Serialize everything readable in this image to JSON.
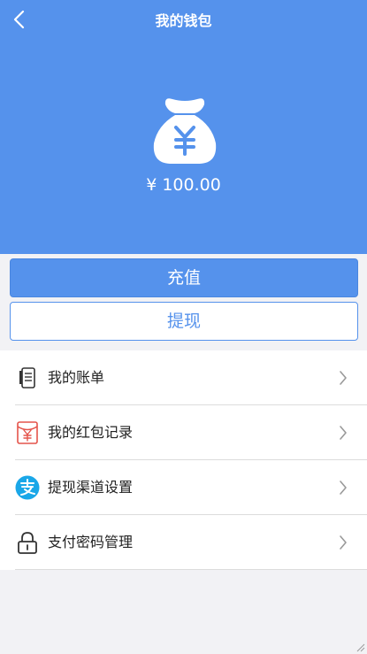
{
  "header": {
    "title": "我的钱包",
    "balance": "¥ 100.00",
    "back_icon": "chevron-left-icon",
    "bag_icon": "money-bag-icon",
    "background_color": "#5592ec"
  },
  "actions": {
    "recharge_label": "充值",
    "withdraw_label": "提现"
  },
  "menu": {
    "items": [
      {
        "label": "我的账单",
        "icon": "bill-icon"
      },
      {
        "label": "我的红包记录",
        "icon": "red-packet-icon"
      },
      {
        "label": "提现渠道设置",
        "icon": "alipay-icon"
      },
      {
        "label": "支付密码管理",
        "icon": "lock-icon"
      }
    ]
  },
  "colors": {
    "primary": "#5592ec",
    "red_packet": "#e4544b",
    "alipay": "#1aa7e8"
  }
}
